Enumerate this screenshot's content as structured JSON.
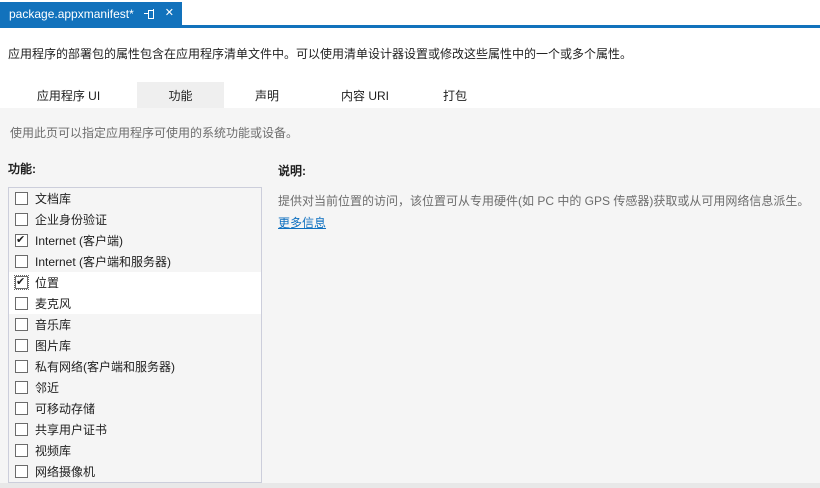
{
  "window": {
    "tab_title": "package.appxmanifest*",
    "pin_icon": "pin",
    "close_icon": "✕"
  },
  "intro_text": "应用程序的部署包的属性包含在应用程序清单文件中。可以使用清单设计器设置或修改这些属性中的一个或多个属性。",
  "nav_tabs": [
    {
      "label": "应用程序 UI",
      "selected": false
    },
    {
      "label": "功能",
      "selected": true
    },
    {
      "label": "声明",
      "selected": false
    },
    {
      "label": "内容 URI",
      "selected": false
    },
    {
      "label": "打包",
      "selected": false
    }
  ],
  "page_hint": "使用此页可以指定应用程序可使用的系统功能或设备。",
  "capabilities": {
    "label": "功能:",
    "items": [
      {
        "label": "文档库",
        "checked": false,
        "selected": false,
        "hover": false
      },
      {
        "label": "企业身份验证",
        "checked": false,
        "selected": false,
        "hover": false
      },
      {
        "label": "Internet (客户端)",
        "checked": true,
        "selected": false,
        "hover": false
      },
      {
        "label": "Internet (客户端和服务器)",
        "checked": false,
        "selected": false,
        "hover": false
      },
      {
        "label": "位置",
        "checked": true,
        "selected": true,
        "hover": false
      },
      {
        "label": "麦克风",
        "checked": false,
        "selected": false,
        "hover": true
      },
      {
        "label": "音乐库",
        "checked": false,
        "selected": false,
        "hover": false
      },
      {
        "label": "图片库",
        "checked": false,
        "selected": false,
        "hover": false
      },
      {
        "label": "私有网络(客户端和服务器)",
        "checked": false,
        "selected": false,
        "hover": false
      },
      {
        "label": "邻近",
        "checked": false,
        "selected": false,
        "hover": false
      },
      {
        "label": "可移动存储",
        "checked": false,
        "selected": false,
        "hover": false
      },
      {
        "label": "共享用户证书",
        "checked": false,
        "selected": false,
        "hover": false
      },
      {
        "label": "视频库",
        "checked": false,
        "selected": false,
        "hover": false
      },
      {
        "label": "网络摄像机",
        "checked": false,
        "selected": false,
        "hover": false
      }
    ]
  },
  "description": {
    "label": "说明:",
    "text": "提供对当前位置的访问，该位置可从专用硬件(如 PC 中的 GPS 传感器)获取或从可用网络信息派生。",
    "link": "更多信息"
  },
  "colors": {
    "accent_blue": "#1272bc",
    "link_blue": "#0e70c0",
    "body_grey": "#f5f5f5",
    "selected_tab_grey": "#efefef"
  }
}
